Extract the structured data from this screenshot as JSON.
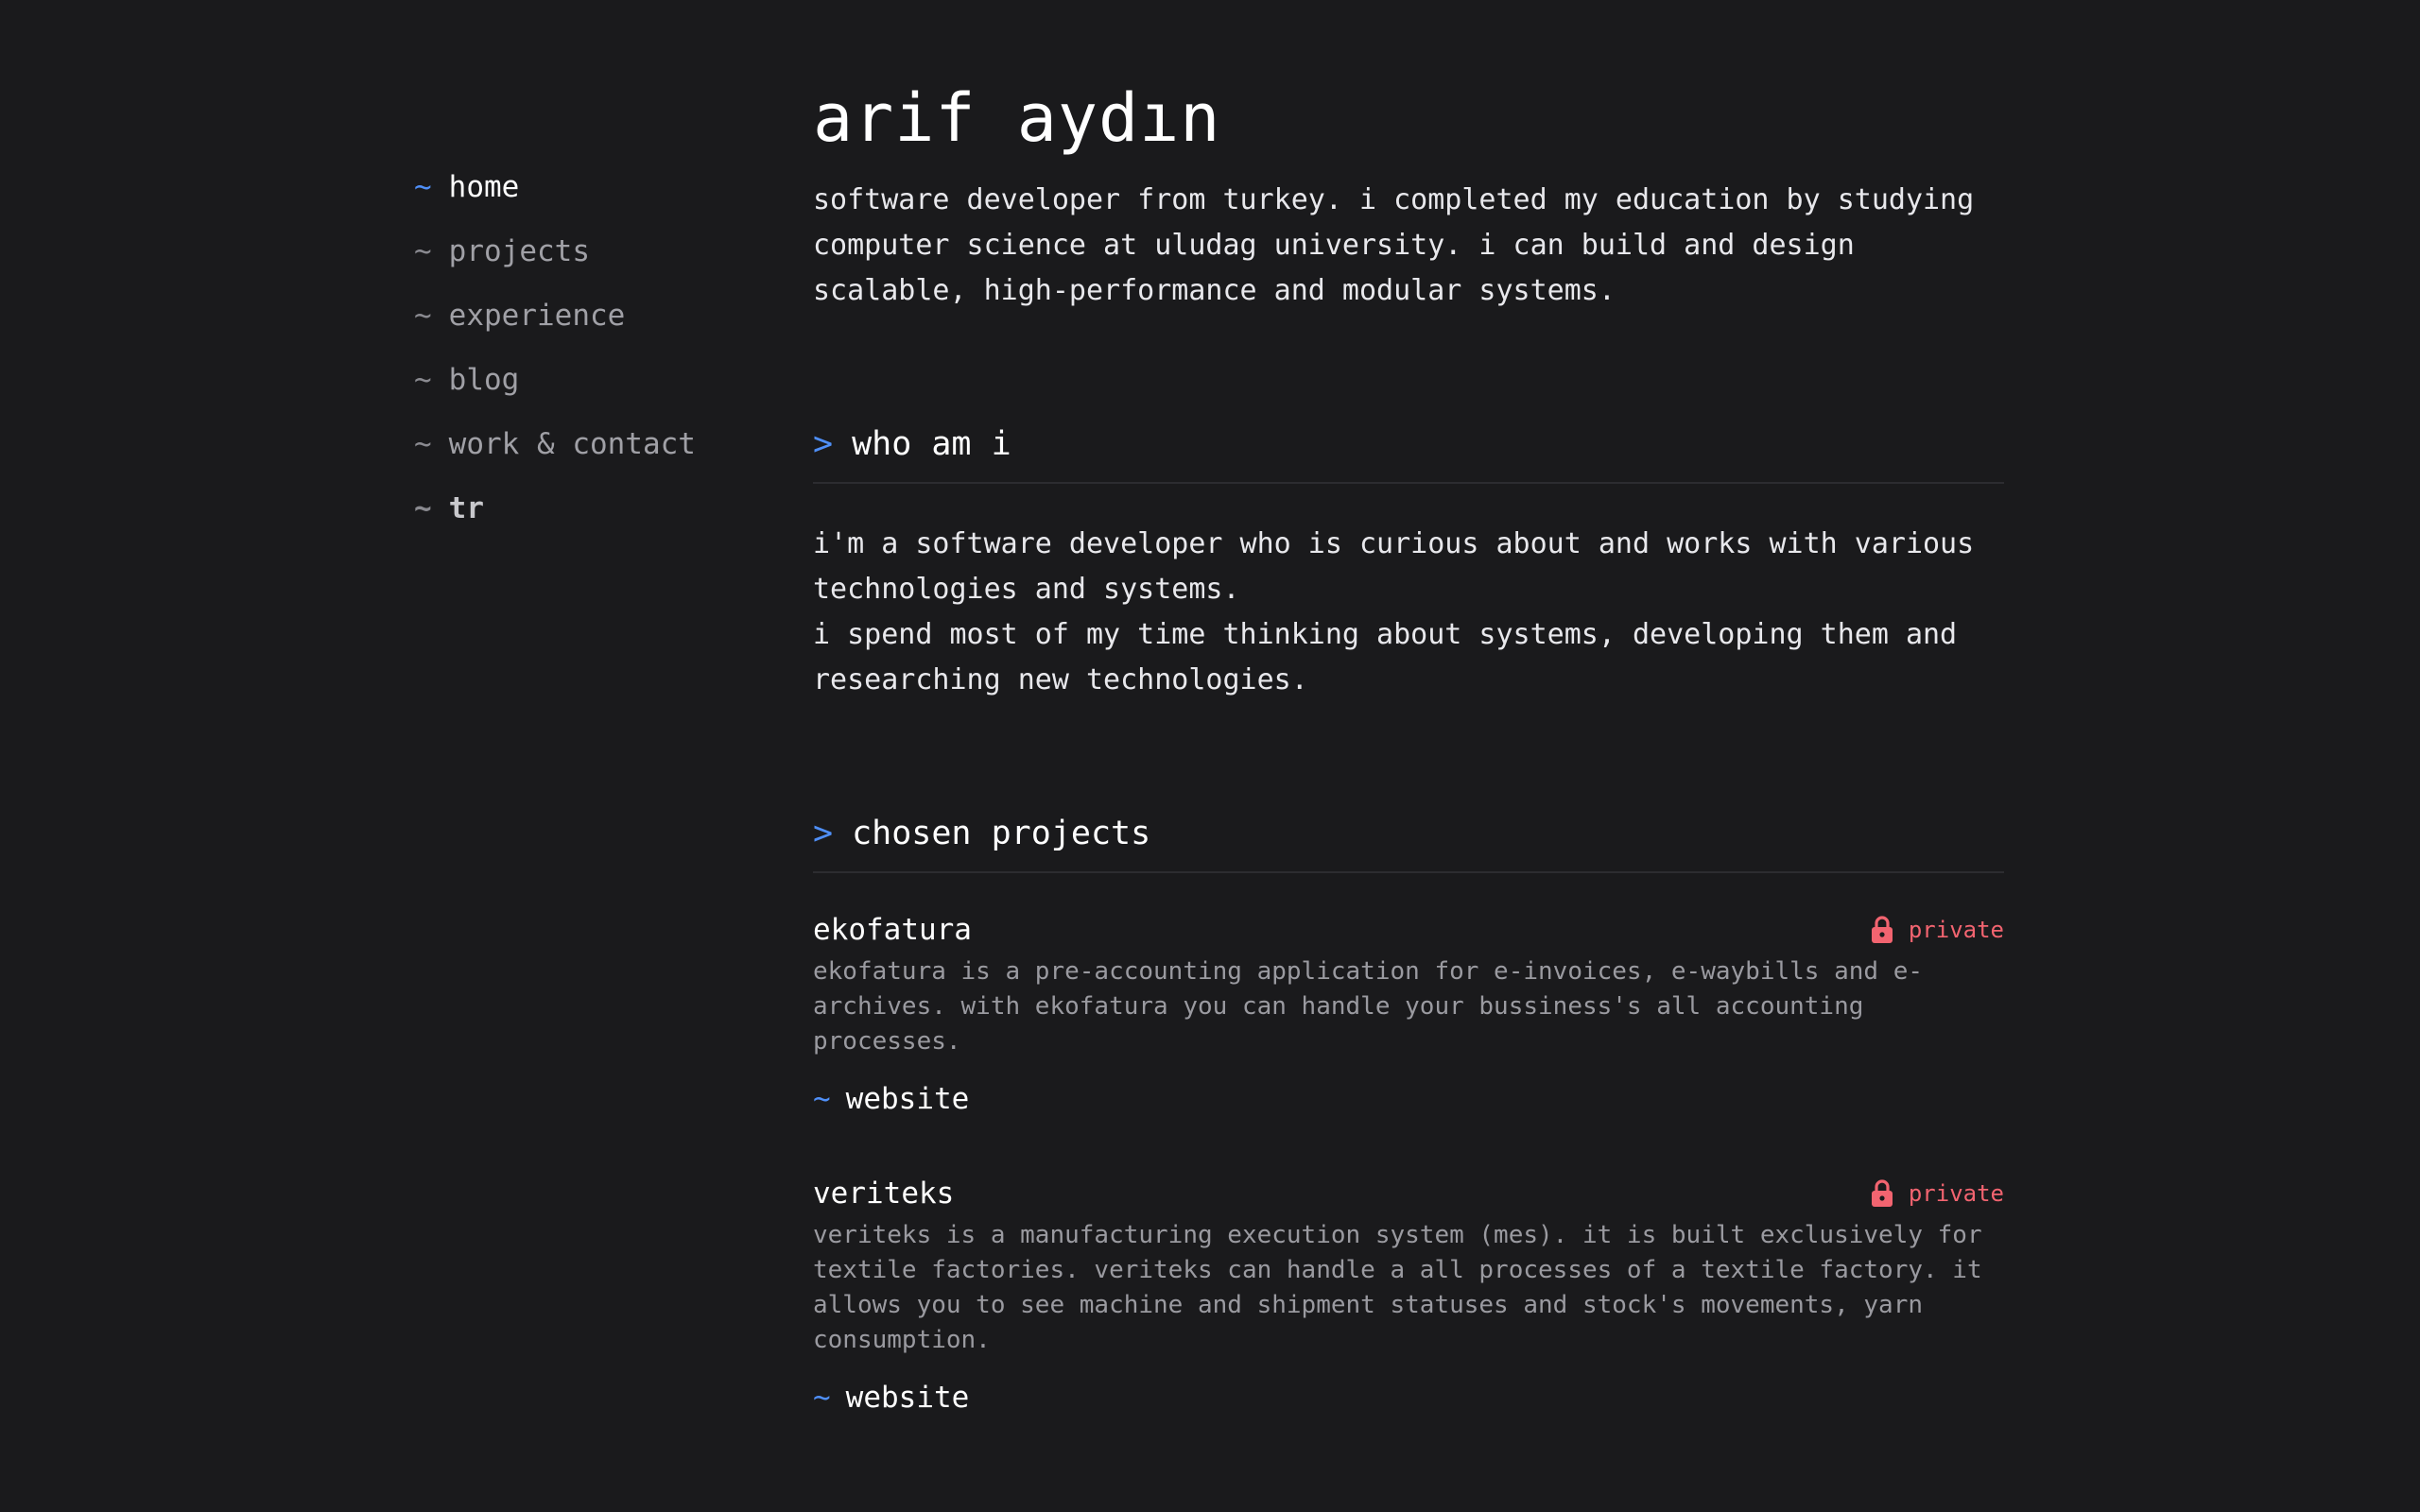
{
  "nav": {
    "items": [
      {
        "prefix": "~",
        "label": "home"
      },
      {
        "prefix": "~",
        "label": "projects"
      },
      {
        "prefix": "~",
        "label": "experience"
      },
      {
        "prefix": "~",
        "label": "blog"
      },
      {
        "prefix": "~",
        "label": "work & contact"
      },
      {
        "prefix": "~",
        "label": "tr"
      }
    ]
  },
  "header": {
    "title": "arif aydın",
    "intro": "software developer from turkey. i completed my education by studying computer science at uludag university. i can build and design scalable, high-performance and modular systems."
  },
  "who": {
    "arrow": ">",
    "heading": "who am i",
    "paragraph1": "i'm a software developer who is curious about and works with various technologies and systems.",
    "paragraph2": "i spend most of my time thinking about systems, developing them and researching new technologies."
  },
  "projects": {
    "arrow": ">",
    "heading": "chosen projects",
    "items": [
      {
        "name": "ekofatura",
        "badge": "private",
        "description": "ekofatura is a pre-accounting application for e-invoices, e-waybills and e-archives. with ekofatura you can handle your bussiness's all accounting processes.",
        "link_prefix": "~",
        "link_label": "website"
      },
      {
        "name": "veriteks",
        "badge": "private",
        "description": "veriteks is a manufacturing execution system (mes). it is built exclusively for textile factories. veriteks can handle a all processes of a textile factory. it allows you to see machine and shipment statuses and stock's movements, yarn consumption.",
        "link_prefix": "~",
        "link_label": "website"
      }
    ]
  },
  "colors": {
    "background": "#1a1a1c",
    "accent": "#4f8ff7",
    "private": "#f26470"
  }
}
